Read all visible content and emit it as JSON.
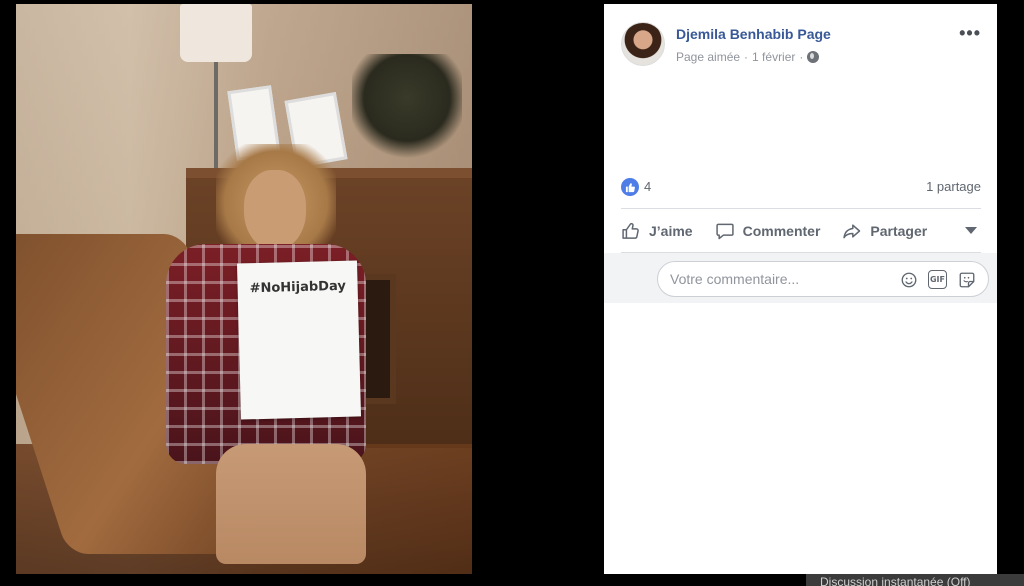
{
  "post": {
    "page_name": "Djemila Benhabib Page",
    "status": "Page aimée",
    "separator": "·",
    "date": "1 février",
    "visibility_icon": "globe-icon",
    "more_icon": "more-options-icon"
  },
  "photo": {
    "sign_text": "#NoHijabDay"
  },
  "stats": {
    "like_count": "4",
    "share_count": "1 partage"
  },
  "actions": {
    "like_label": "J’aime",
    "comment_label": "Commenter",
    "share_label": "Partager"
  },
  "comment": {
    "placeholder": "Votre commentaire..."
  },
  "chat": {
    "label": "Discussion instantanée (Off)"
  },
  "colors": {
    "link_blue": "#385898",
    "like_badge": "#4e7de8",
    "muted_text": "#606770"
  }
}
